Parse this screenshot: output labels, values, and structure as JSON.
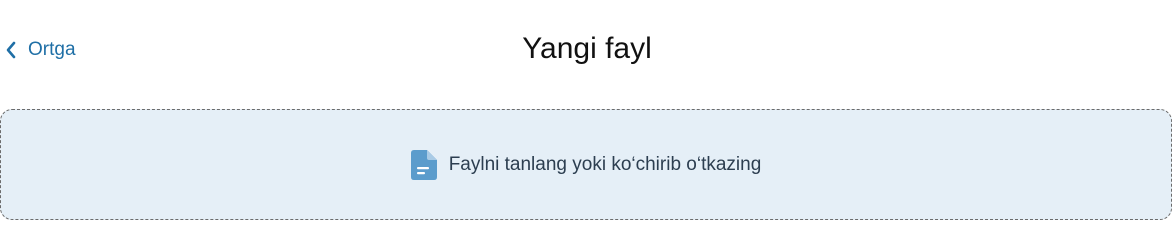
{
  "header": {
    "back_label": "Ortga",
    "title": "Yangi fayl"
  },
  "dropzone": {
    "text": "Faylni tanlang yoki ko‘chirib o‘tkazing",
    "icon": "file-icon"
  },
  "colors": {
    "link": "#1f6fa6",
    "dropzone_bg": "#e5eff7",
    "icon": "#5b9ccc",
    "text": "#2c3e50"
  }
}
